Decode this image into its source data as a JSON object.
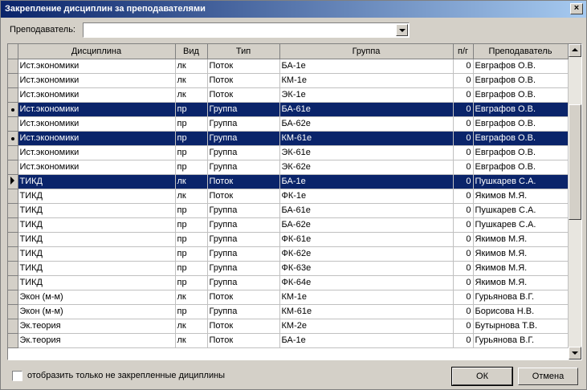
{
  "window": {
    "title": "Закрепление дисциплин за преподавателями",
    "close_glyph": "×"
  },
  "filter": {
    "teacher_label": "Преподаватель:",
    "teacher_value": ""
  },
  "grid": {
    "headers": [
      "Дисциплина",
      "Вид",
      "Тип",
      "Группа",
      "п/г",
      "Преподаватель"
    ],
    "rows": [
      {
        "indicator": "",
        "selected": false,
        "cells": [
          "Ист.экономики",
          "лк",
          "Поток",
          "БА-1е",
          "0",
          "Евграфов О.В."
        ]
      },
      {
        "indicator": "",
        "selected": false,
        "cells": [
          "Ист.экономики",
          "лк",
          "Поток",
          "КМ-1е",
          "0",
          "Евграфов О.В."
        ]
      },
      {
        "indicator": "",
        "selected": false,
        "cells": [
          "Ист.экономики",
          "лк",
          "Поток",
          "ЭК-1е",
          "0",
          "Евграфов О.В."
        ]
      },
      {
        "indicator": "dot",
        "selected": true,
        "cells": [
          "Ист.экономики",
          "пр",
          "Группа",
          "БА-61е",
          "0",
          "Евграфов О.В."
        ]
      },
      {
        "indicator": "",
        "selected": false,
        "cells": [
          "Ист.экономики",
          "пр",
          "Группа",
          "БА-62е",
          "0",
          "Евграфов О.В."
        ]
      },
      {
        "indicator": "dot",
        "selected": true,
        "cells": [
          "Ист.экономики",
          "пр",
          "Группа",
          "КМ-61е",
          "0",
          "Евграфов О.В."
        ]
      },
      {
        "indicator": "",
        "selected": false,
        "cells": [
          "Ист.экономики",
          "пр",
          "Группа",
          "ЭК-61е",
          "0",
          "Евграфов О.В."
        ]
      },
      {
        "indicator": "",
        "selected": false,
        "cells": [
          "Ист.экономики",
          "пр",
          "Группа",
          "ЭК-62е",
          "0",
          "Евграфов О.В."
        ]
      },
      {
        "indicator": "arrow",
        "selected": true,
        "cells": [
          "ТИКД",
          "лк",
          "Поток",
          "БА-1е",
          "0",
          "Пушкарев С.А."
        ]
      },
      {
        "indicator": "",
        "selected": false,
        "cells": [
          "ТИКД",
          "лк",
          "Поток",
          "ФК-1е",
          "0",
          "Якимов М.Я."
        ]
      },
      {
        "indicator": "",
        "selected": false,
        "cells": [
          "ТИКД",
          "пр",
          "Группа",
          "БА-61е",
          "0",
          "Пушкарев С.А."
        ]
      },
      {
        "indicator": "",
        "selected": false,
        "cells": [
          "ТИКД",
          "пр",
          "Группа",
          "БА-62е",
          "0",
          "Пушкарев С.А."
        ]
      },
      {
        "indicator": "",
        "selected": false,
        "cells": [
          "ТИКД",
          "пр",
          "Группа",
          "ФК-61е",
          "0",
          "Якимов М.Я."
        ]
      },
      {
        "indicator": "",
        "selected": false,
        "cells": [
          "ТИКД",
          "пр",
          "Группа",
          "ФК-62е",
          "0",
          "Якимов М.Я."
        ]
      },
      {
        "indicator": "",
        "selected": false,
        "cells": [
          "ТИКД",
          "пр",
          "Группа",
          "ФК-63е",
          "0",
          "Якимов М.Я."
        ]
      },
      {
        "indicator": "",
        "selected": false,
        "cells": [
          "ТИКД",
          "пр",
          "Группа",
          "ФК-64е",
          "0",
          "Якимов М.Я."
        ]
      },
      {
        "indicator": "",
        "selected": false,
        "cells": [
          "Экон (м-м)",
          "лк",
          "Поток",
          "КМ-1е",
          "0",
          "Гурьянова В.Г."
        ]
      },
      {
        "indicator": "",
        "selected": false,
        "cells": [
          "Экон (м-м)",
          "пр",
          "Группа",
          "КМ-61е",
          "0",
          "Борисова Н.В."
        ]
      },
      {
        "indicator": "",
        "selected": false,
        "cells": [
          "Эк.теория",
          "лк",
          "Поток",
          "КМ-2е",
          "0",
          "Бутырнова Т.В."
        ]
      },
      {
        "indicator": "",
        "selected": false,
        "cells": [
          "Эк.теория",
          "лк",
          "Поток",
          "БА-1е",
          "0",
          "Гурьянова В.Г."
        ]
      }
    ]
  },
  "footer": {
    "checkbox_label": "отобразить только не закрепленные дициплины",
    "checkbox_checked": false,
    "ok_label": "ОК",
    "cancel_label": "Отмена"
  }
}
